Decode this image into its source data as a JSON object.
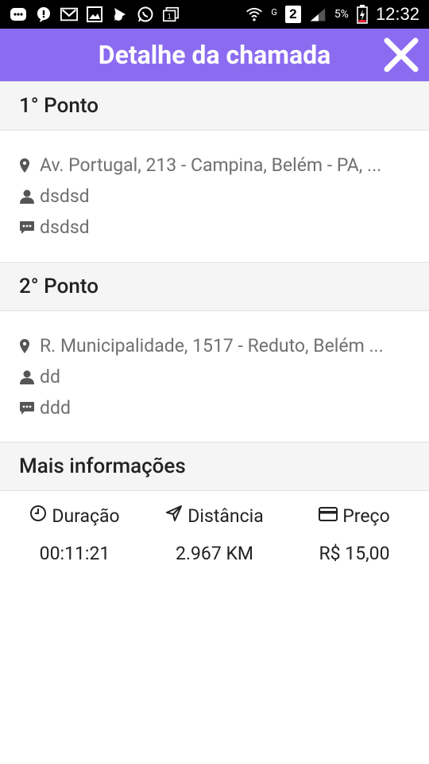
{
  "status_bar": {
    "battery": "5%",
    "time": "12:32",
    "sim": "2",
    "network": "G"
  },
  "app_bar": {
    "title": "Detalhe da chamada",
    "close_icon": "close-icon"
  },
  "points": [
    {
      "header": "1° Ponto",
      "address": "Av. Portugal, 213 - Campina, Belém - PA, ...",
      "person": "dsdsd",
      "note": "dsdsd"
    },
    {
      "header": "2° Ponto",
      "address": "R. Municipalidade, 1517 - Reduto, Belém ...",
      "person": "dd",
      "note": "ddd"
    }
  ],
  "more_info": {
    "header": "Mais informações",
    "duration_label": "Duração",
    "duration_value": "00:11:21",
    "distance_label": "Distância",
    "distance_value": "2.967 KM",
    "price_label": "Preço",
    "price_value": "R$ 15,00"
  },
  "colors": {
    "accent": "#8b6cf0",
    "section_bg": "#f5f5f5"
  }
}
